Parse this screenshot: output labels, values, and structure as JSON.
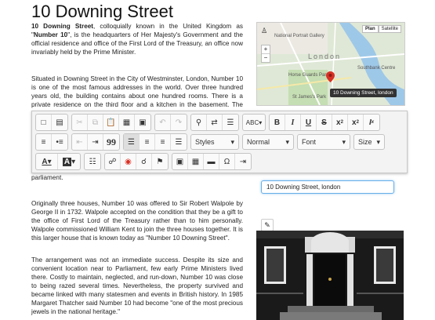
{
  "page": {
    "title": "10 Downing Street",
    "intro_bold1": "10 Downing Street",
    "intro_text1": ", colloquially known in the United Kingdom as \"",
    "intro_bold2": "Number 10",
    "intro_text2": "\", is the headquarters of Her Majesty's Government and the official residence and office of the First Lord of the Treasury, an office now invariably held by the Prime Minister.",
    "para2": "Situated in Downing Street in the City of Westminster, London, Number 10 is one of the most famous addresses in the world. Over three hundred years old, the building contains about one hundred rooms. There is a private residence on the third floor and a kitchen in the basement. The other floors",
    "para2_tail": "parliament.",
    "para3": "Originally three houses, Number 10 was offered to Sir Robert Walpole by George II in 1732. Walpole accepted on the condition that they be a gift to the office of First Lord of the Treasury rather than to him personally. Walpole commissioned William Kent to join the three houses together. It is this larger house that is known today as \"Number 10 Downing Street\".",
    "para4": "The arrangement was not an immediate success. Despite its size and convenient location near to Parliament, few early Prime Ministers lived there. Costly to maintain, neglected, and run-down, Number 10 was close to being razed several times. Nevertheless, the property survived and became linked with many statesmen and events in British history. In 1985 Margaret Thatcher said Number 10 had become \"one of the most precious jewels in the national heritage.\""
  },
  "map": {
    "btn_plan": "Plan",
    "btn_satellite": "Satellite",
    "label_gallery": "National Portrait Gallery",
    "label_london": "London",
    "label_southbank": "Southbank Centre",
    "label_parade": "Horse Guards Parade",
    "label_stjames": "St James's Park",
    "callout": "10 Downing Street, london",
    "zoom_in": "+",
    "zoom_out": "−"
  },
  "toolbar": {
    "styles": "Styles",
    "format": "Normal",
    "font": "Font",
    "size": "Size",
    "omega": "Ω",
    "quote": "99",
    "tx": "Tx",
    "x2": "x",
    "sub": "2"
  },
  "address": {
    "value": "10 Downing Street, london"
  },
  "colors": {
    "accent": "#66afe9",
    "pin": "#d93025",
    "river": "#9ec8e8"
  }
}
